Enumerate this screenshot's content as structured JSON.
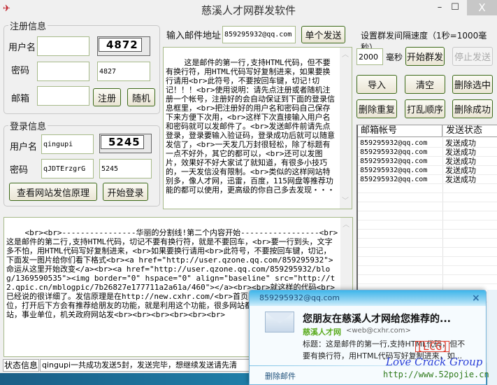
{
  "window": {
    "title": "慈溪人才网群发软件",
    "min_label": "–",
    "max_label": "☐",
    "close_label": "X"
  },
  "register": {
    "legend": "注册信息",
    "username_label": "用户名",
    "password_label": "密码",
    "email_label": "邮箱",
    "username_value": "",
    "password_value": "",
    "email_value": "",
    "captcha_image_text": "4872",
    "captcha_value": "4827",
    "register_button": "注册",
    "random_button": "随机"
  },
  "login": {
    "legend": "登录信息",
    "username_label": "用户名",
    "password_label": "密码",
    "username_value": "qingupi",
    "password_value": "qJDTErzgrG",
    "captcha_image_text": "5245",
    "captcha_value": "5245",
    "principle_button": "查看网站发信原理",
    "login_button": "开始登录"
  },
  "single_send": {
    "label": "输入邮件地址",
    "email_value": "859295932@qq.com",
    "send_button": "单个发送"
  },
  "message_first": "这是邮件的第一行,支持HTML代码，但不要有换行符，用HTML代码写好复制进来，如果要换行请用<br>此符号，不要按回车键，切记!切记！！！<br>使用说明：请先点注册或者随机注册一个帐号，注册好的会自动保证到下面的登录信息框里，<br>把注册好的用户名和密码自己保存下来方便下次用，<br>这样下次直接输入用户名和密码就可以发邮件了。<br>发送邮件前请先点登录，登录要输入验证码，登录成功后就可以随意发信了，<br>一天发几万封很轻松，除了标题有一点不好外，其它的都可以，<br>还可以发图片，效果好不好大家试了就知道，有很多小技巧的，一天发信没有限制。<br>类似的这样网站特别多，像人才网，迅雷，百度，115网盘等推荐功能的都可以使用，更高级的你自己多去发现・・・",
  "message_second": "<br><br>----------------华丽的分割线!第二个内容开始-----------------<br>这是邮件的第二行,支持HTML代码，切记不要有换行符，就是不要回车，<br>要一行到头，文字多不怕，用HTML代码写好复制进来，<br>如果要换行请用<br>此符号，不要按回车键，切记，下面发一图片给你们看下格式<br><a href=\"http://user.qzone.qq.com/859295932\">命运从这里开始改变</a><br><a href=\"http://user.qzone.qq.com/859295932/blog/1369590535\"><img border=\"0\" hspace=\"0\" align=\"baseline\" src=\"http://t2.qpic.cn/mblogpic/7b26827e177711a2a61a/460\"></a><br><br>就这样的代码<br>已经说的很详细了。发信原理是在http://new.cxhr.com/<br>首页随便找一个公司招聘的职位，打开后下方会有推荐给朋友的功能，就是利用这个功能，很多网站都有这功能，正常的找大网站，事业单位，机关政府网站发<br><br><br><br><br><br>",
  "interval": {
    "label": "设置群发间隔速度（1秒=1000毫秒）",
    "value": "2000",
    "unit": "毫秒",
    "start_button": "开始群发",
    "stop_button": "停止发送"
  },
  "actions": {
    "import": "导入",
    "clear": "清空",
    "delete_selected": "删除选中",
    "delete_duplicates": "删除重复",
    "shuffle": "打乱顺序",
    "delete_success": "删除成功"
  },
  "table": {
    "columns": [
      "邮箱帐号",
      "发送状态"
    ],
    "rows": [
      {
        "email": "859295932@qq.com",
        "status": "发送成功"
      },
      {
        "email": "859295932@qq.com",
        "status": "发送成功"
      },
      {
        "email": "859295932@qq.com",
        "status": "发送成功"
      },
      {
        "email": "859295932@qq.com",
        "status": "发送成功"
      },
      {
        "email": "859295932@qq.com",
        "status": "发送成功"
      }
    ]
  },
  "status": {
    "label": "状态信息",
    "text": "qingupi一共成功发送5封，发送完毕，想继续发送请先清"
  },
  "notification": {
    "recipient": "859295932@qq.com",
    "close_label": "×",
    "title": "您朋友在慈溪人才网给您推荐的...",
    "from_name": "慈溪人才网",
    "from_address": "<web@cxhr.com>",
    "body": "标题：这是邮件的第一行,支持HTML代码，但不要有换行符，用HTML代码写好复制进来，如...",
    "delete_link": "删除邮件"
  },
  "watermark": {
    "tag": "[LCG]",
    "group": "Love Crack Group",
    "url": "http://www.52pojie.cn"
  }
}
